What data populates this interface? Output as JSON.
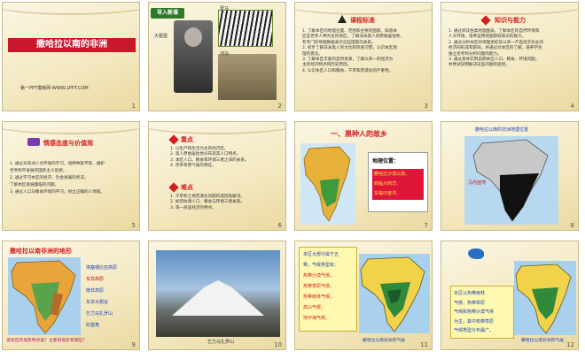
{
  "slides": [
    {
      "num": "1",
      "title": "撒哈拉以南的非洲",
      "footer": "第一PPT模板网-WWW.1PPT.COM"
    },
    {
      "num": "2",
      "badge": "导入新课",
      "labels": [
        "大猩猩",
        "斑马",
        "河马"
      ]
    },
    {
      "num": "3",
      "heading": "课程标准",
      "lines": [
        "1. 了解本区的地理位置、范围和主要的国家，知道本",
        "区是世界人种为主的地区，了解非洲黑人的原始居住地，",
        "有专门的地理数据表示这些国家的关系。",
        "2. 初步了解非洲黑人的文化和风俗习惯，认识本区地",
        "理的变化。",
        "3. 了解本区丰富的自然资源，了解以单一的经济为",
        "主的经济特点和历史原因。",
        "4. 认识本区人口和粮食、干旱和荒漠化的严重性。"
      ]
    },
    {
      "num": "4",
      "heading": "知识与能力",
      "lines": [
        "1. 通过阅读各类地理图表，了解本区的自然环境和",
        "人文环境，培养运用地图获取知识的能力。",
        "2. 通过分析本区的地理坐标及以单一产品经济为主的",
        "经济的形成和影响，并通过对本区的了解，培养学生",
        "独立思考和分析问题的能力。",
        "3. 通过具体实例说明本区人口、粮食、环境问题，",
        "并尝试说明解决这些问题的途径。"
      ]
    },
    {
      "num": "5",
      "heading": "情感态度与价值观",
      "lines": [
        "1. 通过对非洲人文环境的学习，培养种族平等、维护",
        "世界和平发展的国际主义思想。",
        "2. 通过学习本区的经济、社会发展的状况，",
        "了解本区发展面临的问题。",
        "3. 通过人口与粮食环境的学习，树立正确的人地观。"
      ]
    },
    {
      "num": "6",
      "h1": "重点",
      "lines1": [
        "1. 以生产和生活为主的经济区。",
        "2. 黑人原始居住地分布及其人口特点。",
        "3. 本区人口、粮食和环境三者之间的关系。",
        "4. 热带草原气候的特征。"
      ],
      "h2": "难点",
      "lines2": [
        "1. 干旱和土地荒漠化问题的成因及解决。",
        "2. 如何协调人口、粮食与环境三者关系。",
        "3. 单一商品经济的特点。"
      ]
    },
    {
      "num": "7",
      "heading": "一、黑种人的故乡",
      "boxtitle": "地理位置：",
      "boxlines": [
        "撒哈拉沙漠以南，",
        "西临大西洋，",
        "东临印度洋。"
      ]
    },
    {
      "num": "8",
      "heading": "撒哈拉以南的非洲地理位置",
      "label": "几内亚湾"
    },
    {
      "num": "9",
      "heading": "撒哈拉以南非洲的地形",
      "labels": [
        "埃塞俄比亚高原",
        "东非高原",
        "南非高原",
        "东非大裂谷",
        "乞力马扎罗山",
        "好望角"
      ],
      "footer": "该地区的地势特点是？主要的地形有哪些？"
    },
    {
      "num": "10",
      "caption": "乞力马扎罗山"
    },
    {
      "num": "11",
      "boxtitle": "本区大部分属于五",
      "lines": [
        "带，气候类型有：",
        "热带沙漠气候，",
        "热带草原气候，",
        "热带雨林气候，",
        "高山气候，",
        "地中海气候。"
      ],
      "caption": "撒哈拉以南非洲的气候"
    },
    {
      "num": "12",
      "lines": [
        "本区以热带雨林",
        "气候、热带草原",
        "气候和热带沙漠气候",
        "为主，其中热带草原",
        "气候类型分布最广。"
      ],
      "caption": "撒哈拉以南非洲的气候"
    }
  ],
  "colors": {
    "red": "#d11f1f",
    "slideBg": "#f3e8c0",
    "blue": "#1c3fb5"
  }
}
